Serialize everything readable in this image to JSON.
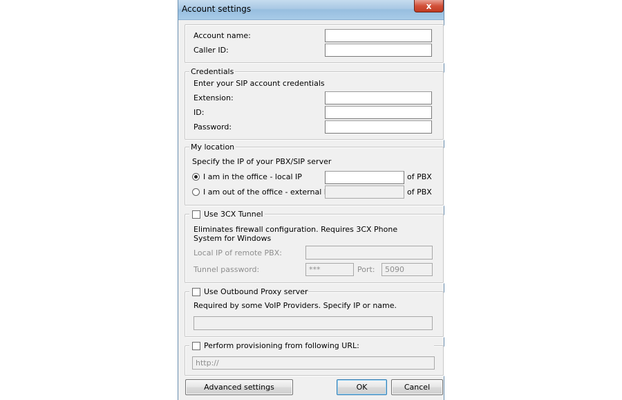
{
  "window": {
    "title": "Account settings",
    "close_glyph": "x",
    "close_icon": "close-icon"
  },
  "account": {
    "name_label": "Account name:",
    "name_value": "",
    "caller_id_label": "Caller ID:",
    "caller_id_value": ""
  },
  "credentials": {
    "legend": "Credentials",
    "hint": "Enter your SIP account credentials",
    "extension_label": "Extension:",
    "id_label": "ID:",
    "password_label": "Password:"
  },
  "location": {
    "legend": "My location",
    "hint": "Specify the IP of your PBX/SIP server",
    "local_label": "I am in the office - local IP",
    "local_selected": true,
    "external_label": "I am out of the office - external IP",
    "of_pbx_1": "of PBX",
    "of_pbx_2": "of PBX"
  },
  "tunnel": {
    "checkbox_label": "Use 3CX Tunnel",
    "checked": false,
    "description": "Eliminates firewall configuration. Requires 3CX Phone System for Windows",
    "local_ip_label": "Local IP of remote PBX:",
    "password_label": "Tunnel password:",
    "password_value": "***",
    "port_label": "Port:",
    "port_value": "5090"
  },
  "proxy": {
    "checkbox_label": "Use Outbound Proxy server",
    "checked": false,
    "description": "Required by some VoIP Providers. Specify IP or name."
  },
  "provisioning": {
    "checkbox_label": "Perform provisioning from following URL:",
    "checked": false,
    "url_value": "http://"
  },
  "buttons": {
    "advanced": "Advanced settings",
    "ok": "OK",
    "cancel": "Cancel"
  }
}
